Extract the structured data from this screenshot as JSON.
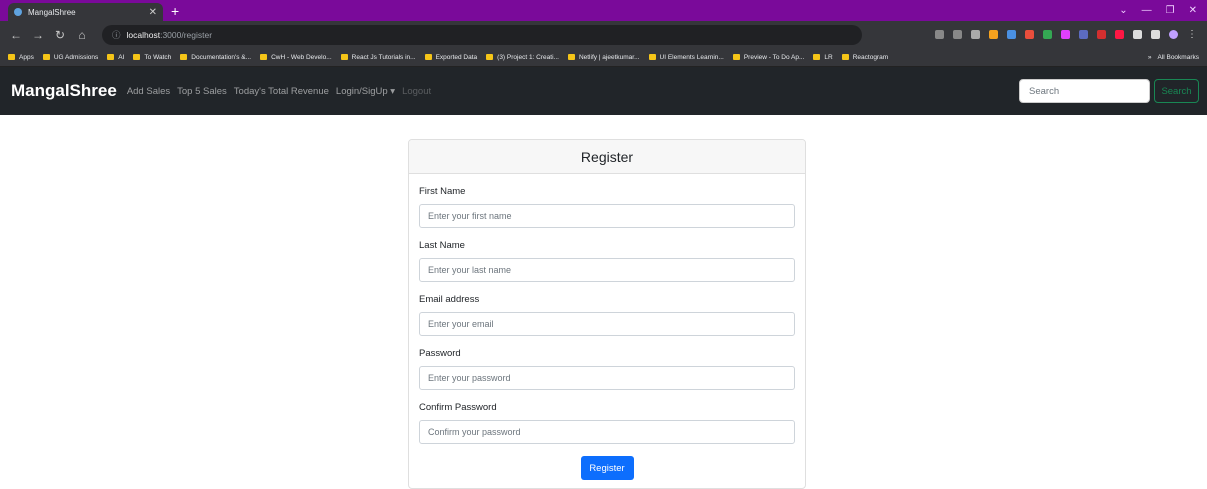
{
  "browser": {
    "tab_title": "MangalShree",
    "url_host": "localhost",
    "url_path": ":3000/register",
    "bookmarks": [
      "Apps",
      "UG Admissions",
      "AI",
      "To Watch",
      "Documentation's &...",
      "CwH - Web Develo...",
      "React Js Tutorials in...",
      "Exported Data",
      "(3) Project 1: Creati...",
      "Netlify | ajeetkumar...",
      "UI Elements Learnin...",
      "Preview - To Do Ap...",
      "LR",
      "Reactogram"
    ],
    "all_bookmarks": "All Bookmarks",
    "overflow": "»"
  },
  "navbar": {
    "brand": "MangalShree",
    "links": [
      "Add Sales",
      "Top 5 Sales",
      "Today's Total Revenue",
      "Login/SigUp ▾",
      "Logout"
    ],
    "search_placeholder": "Search",
    "search_button": "Search"
  },
  "form": {
    "title": "Register",
    "fields": [
      {
        "label": "First Name",
        "placeholder": "Enter your first name"
      },
      {
        "label": "Last Name",
        "placeholder": "Enter your last name"
      },
      {
        "label": "Email address",
        "placeholder": "Enter your email"
      },
      {
        "label": "Password",
        "placeholder": "Enter your password"
      },
      {
        "label": "Confirm Password",
        "placeholder": "Confirm your password"
      }
    ],
    "submit_label": "Register"
  },
  "colors": {
    "accent": "#0d6efd",
    "success": "#198754",
    "navbar": "#212529",
    "tabbar": "#7a0a9a"
  }
}
